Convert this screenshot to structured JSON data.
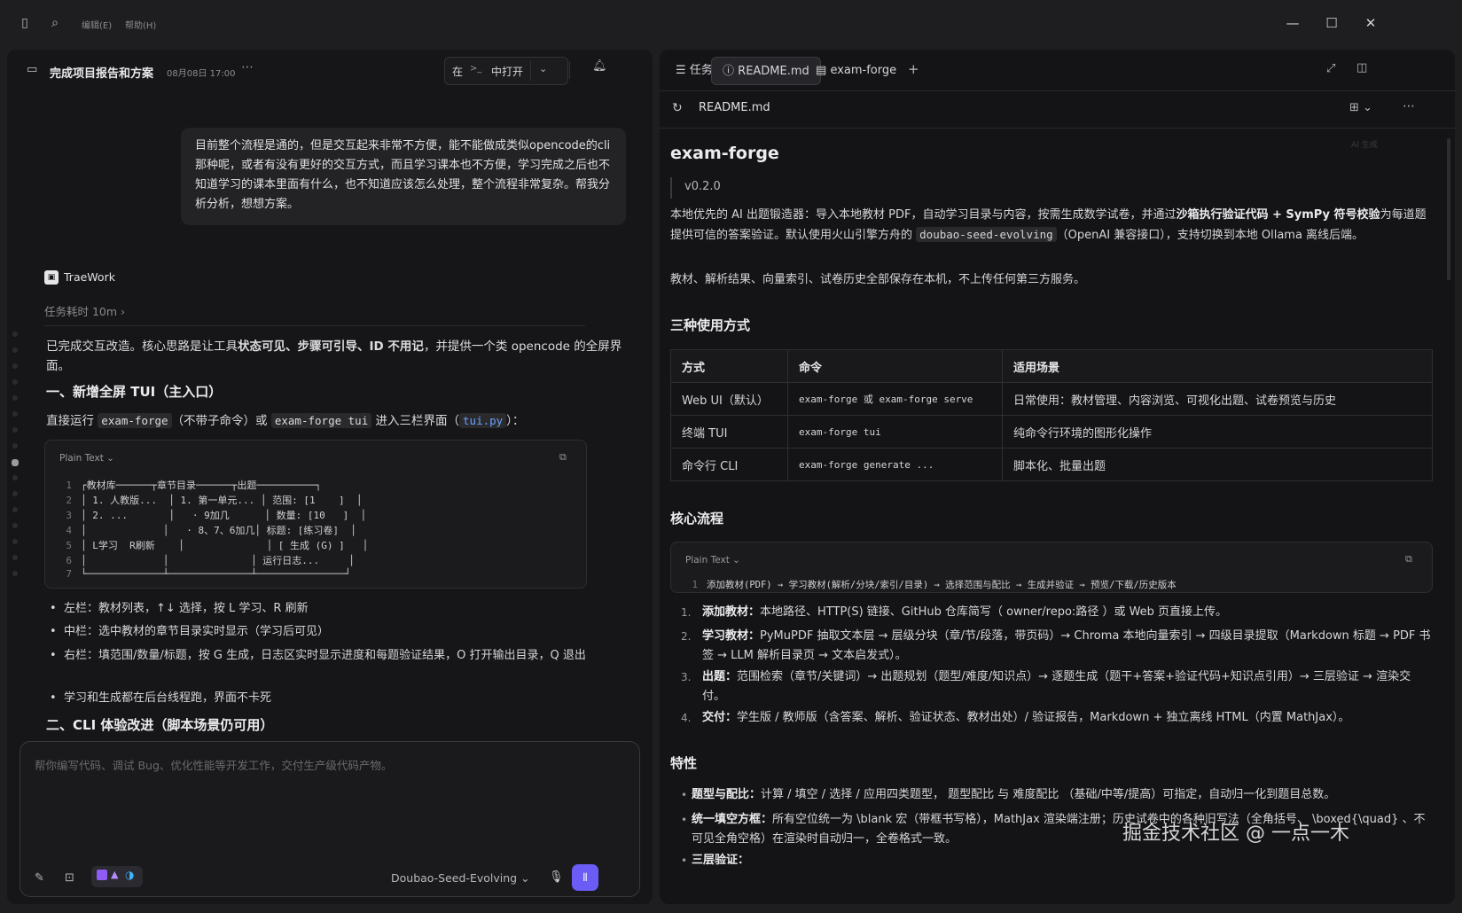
{
  "topbar": {
    "menu_edit": "编辑(E)",
    "menu_help": "帮助(H)"
  },
  "left": {
    "title": "完成项目报告和方案",
    "date": "08月08日 17:00",
    "open_prefix": "在",
    "open_label": "中打开",
    "user_message": "目前整个流程是通的，但是交互起来非常不方便，能不能做成类似opencode的cli那种呢，或者有没有更好的交互方式，而且学习课本也不方便，学习完成之后也不知道学习的课本里面有什么，也不知道应该怎么处理，整个流程非常复杂。帮我分析分析，想想方案。",
    "agent_name": "TraeWork",
    "task_time": "任务耗时 10m",
    "summary_a": "已完成交互改造。核心思路是让工具",
    "summary_b": "状态可见、步骤可引导、ID 不用记",
    "summary_c": "，并提供一个类 opencode 的全屏界面。",
    "heading1": "一、新增全屏 TUI（主入口）",
    "run_a": "直接运行 ",
    "run_code1": "exam-forge",
    "run_b": "（不带子命令）或 ",
    "run_code2": "exam-forge tui",
    "run_c": " 进入三栏界面（",
    "run_link": "tui.py",
    "run_d": "）：",
    "code_lang": "Plain Text",
    "code_lines": [
      {
        "n": "1",
        "t": "┌教材库──────┬章节目录──────┬出题──────────┐"
      },
      {
        "n": "2",
        "t": "│ 1. 人教版...  │ 1. 第一单元... │ 范围: [1    ]  │"
      },
      {
        "n": "3",
        "t": "│ 2. ...       │   · 9加几      │ 数量: [10   ]  │"
      },
      {
        "n": "4",
        "t": "│             │   · 8、7、6加几│ 标题: [练习卷]  │"
      },
      {
        "n": "5",
        "t": "│ L学习  R刷新    │              │ [ 生成 (G) ]   │"
      },
      {
        "n": "6",
        "t": "│             │              │ 运行日志...     │"
      },
      {
        "n": "7",
        "t": "└─────────────┴──────────────┴───────────────┘"
      }
    ],
    "bullets": [
      "左栏：教材列表，↑↓ 选择，按 L 学习、R 刷新",
      "中栏：选中教材的章节目录实时显示（学习后可见）",
      "右栏：填范围/数量/标题，按 G 生成，日志区实时显示进度和每题验证结果，O 打开输出目录，Q 退出",
      "学习和生成都在后台线程跑，界面不卡死"
    ],
    "heading2": "二、CLI 体验改进（脚本场景仍可用）",
    "input_placeholder": "帮你编写代码、调试 Bug、优化性能等开发工作，交付生产级代码产物。",
    "model": "Doubao-Seed-Evolving"
  },
  "right": {
    "tabs": [
      "任务摘要",
      "README.md",
      "exam-forge"
    ],
    "file_name": "README.md",
    "ai_badge": "AI 生成",
    "title": "exam-forge",
    "version": "v0.2.0",
    "intro_a": "本地优先的 AI 出题锻造器：导入本地教材 PDF，自动学习目录与内容，按需生成数学试卷，并通过",
    "intro_b": "沙箱执行验证代码 + SymPy 符号校验",
    "intro_c": "为每道题提供可信的答案验证。默认使用火山引擎方舟的 ",
    "intro_code": "doubao-seed-evolving",
    "intro_d": "（OpenAI 兼容接口），支持切换到本地 Ollama 离线后端。",
    "privacy": "教材、解析结果、向量索引、试卷历史全部保存在本机，不上传任何第三方服务。",
    "h_usage": "三种使用方式",
    "table_headers": [
      "方式",
      "命令",
      "适用场景"
    ],
    "table_rows": [
      [
        "Web UI（默认）",
        "exam-forge 或 exam-forge serve",
        "日常使用：教材管理、内容浏览、可视化出题、试卷预览与历史"
      ],
      [
        "终端 TUI",
        "exam-forge tui",
        "纯命令行环境的图形化操作"
      ],
      [
        "命令行 CLI",
        "exam-forge generate ...",
        "脚本化、批量出题"
      ]
    ],
    "h_flow": "核心流程",
    "flow_lang": "Plain Text",
    "flow_line": "添加教材(PDF) → 学习教材(解析/分块/索引/目录) → 选择范围与配比 → 生成并验证 → 预览/下载/历史版本",
    "steps": [
      {
        "n": "1.",
        "k": "添加教材：",
        "t": "本地路径、HTTP(S) 链接、GitHub 仓库简写（ owner/repo:路径 ）或 Web 页直接上传。"
      },
      {
        "n": "2.",
        "k": "学习教材：",
        "t": "PyMuPDF 抽取文本层 → 层级分块（章/节/段落，带页码）→ Chroma 本地向量索引 → 四级目录提取（Markdown 标题 → PDF 书签 → LLM 解析目录页 → 文本启发式）。"
      },
      {
        "n": "3.",
        "k": "出题：",
        "t": "范围检索（章节/关键词）→ 出题规划（题型/难度/知识点）→ 逐题生成（题干+答案+验证代码+知识点引用）→ 三层验证 → 渲染交付。"
      },
      {
        "n": "4.",
        "k": "交付：",
        "t": "学生版 / 教师版（含答案、解析、验证状态、教材出处）/ 验证报告，Markdown + 独立离线 HTML（内置 MathJax）。"
      }
    ],
    "h_features": "特性",
    "features": [
      {
        "k": "题型与配比：",
        "t": "计算 / 填空 / 选择 / 应用四类题型， 题型配比 与 难度配比 （基础/中等/提高）可指定，自动归一化到题目总数。"
      },
      {
        "k": "统一填空方框：",
        "t": "所有空位统一为 \\blank 宏（带框书写格），MathJax 渲染端注册；历史试卷中的各种旧写法（全角括号、 \\boxed{\\quad} 、不可见全角空格）在渲染时自动归一，全卷格式一致。"
      },
      {
        "k": "三层验证：",
        "t": ""
      }
    ],
    "watermark": "掘金技术社区 @ 一点一木"
  }
}
